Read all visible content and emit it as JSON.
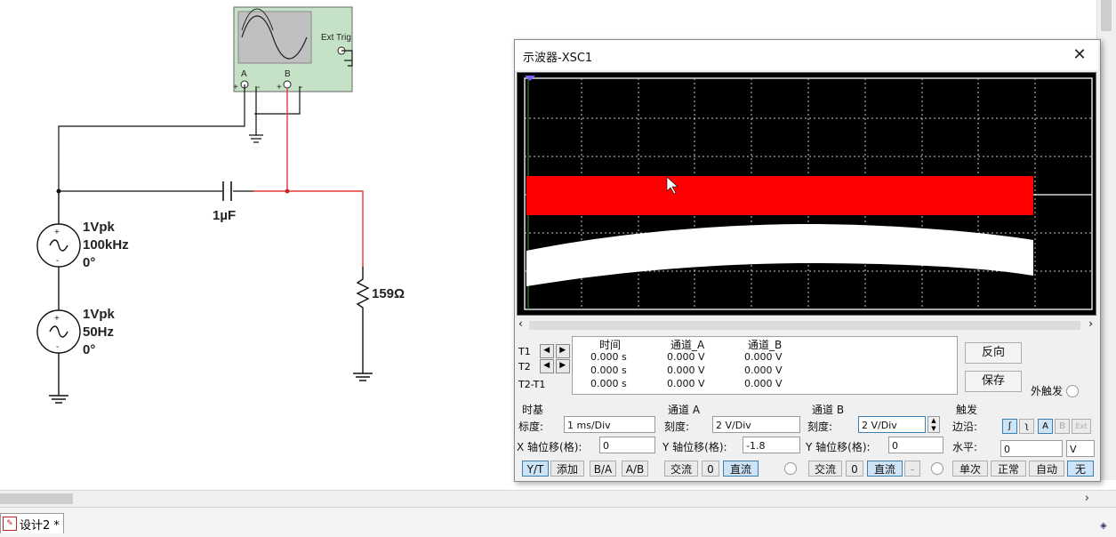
{
  "schematic": {
    "scope_ext_trig": "Ext Trig",
    "scope_a": "A",
    "scope_b": "B",
    "source1": {
      "amp": "1Vpk",
      "freq": "100kHz",
      "phase": "0°"
    },
    "source2": {
      "amp": "1Vpk",
      "freq": "50Hz",
      "phase": "0°"
    },
    "capacitor": "1µF",
    "resistor": "159Ω"
  },
  "window": {
    "title": "示波器-XSC1",
    "close": "✕"
  },
  "readout": {
    "rows": [
      "T1",
      "T2",
      "T2-T1"
    ],
    "headers": {
      "time": "时间",
      "ch_a": "通道_A",
      "ch_b": "通道_B"
    },
    "values": [
      [
        "0.000 s",
        "0.000 V",
        "0.000 V"
      ],
      [
        "0.000 s",
        "0.000 V",
        "0.000 V"
      ],
      [
        "0.000 s",
        "0.000 V",
        "0.000 V"
      ]
    ]
  },
  "buttons": {
    "reverse": "反向",
    "save": "保存",
    "ext_trigger": "外触发"
  },
  "timebase": {
    "title": "时基",
    "scale_label": "标度:",
    "scale": "1 ms/Div",
    "xpos_label": "X 轴位移(格):",
    "xpos": "0",
    "modes": [
      "Y/T",
      "添加",
      "B/A",
      "A/B"
    ]
  },
  "channel_a": {
    "title": "通道 A",
    "scale_label": "刻度:",
    "scale": "2  V/Div",
    "ypos_label": "Y 轴位移(格):",
    "ypos": "-1.8",
    "coupling": [
      "交流",
      "0",
      "直流"
    ]
  },
  "channel_b": {
    "title": "通道 B",
    "scale_label": "刻度:",
    "scale": "2  V/Div",
    "ypos_label": "Y 轴位移(格):",
    "ypos": "0",
    "coupling": [
      "交流",
      "0",
      "直流",
      "-"
    ]
  },
  "trigger": {
    "title": "触发",
    "edge_label": "边沿:",
    "level_label": "水平:",
    "level": "0",
    "level_unit": "V",
    "edge_buttons": [
      "ʃ",
      "ʅ",
      "A",
      "B",
      "Ext"
    ],
    "modes": [
      "单次",
      "正常",
      "自动",
      "无"
    ]
  },
  "tabs": {
    "design": "设计2 *"
  },
  "colors": {
    "channel_a_trace": "#ff0000",
    "channel_b_trace": "#ffffff",
    "screen_bg": "#000000",
    "wire_red": "#e53935"
  }
}
